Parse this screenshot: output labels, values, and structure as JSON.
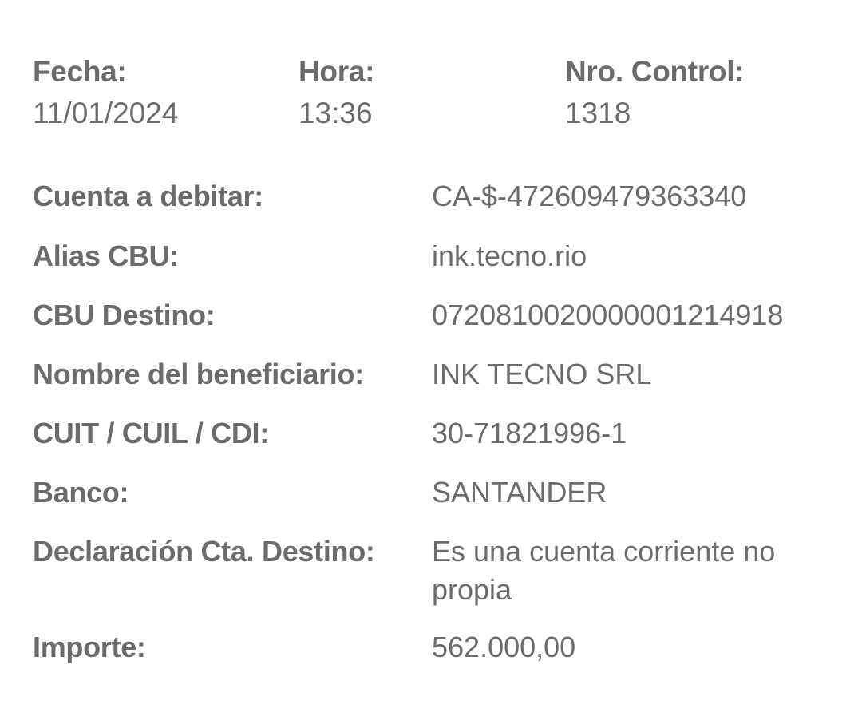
{
  "header": {
    "fecha_label": "Fecha:",
    "fecha_value": "11/01/2024",
    "hora_label": "Hora:",
    "hora_value": "13:36",
    "control_label": "Nro. Control:",
    "control_value": "1318"
  },
  "details": {
    "cuenta_label": "Cuenta a debitar:",
    "cuenta_value": "CA-$-472609479363340",
    "alias_label": "Alias CBU:",
    "alias_value": "ink.tecno.rio",
    "cbu_label": "CBU Destino:",
    "cbu_value": "0720810020000001214918",
    "nombre_label": "Nombre del beneficiario:",
    "nombre_value": "INK TECNO SRL",
    "cuit_label": "CUIT / CUIL / CDI:",
    "cuit_value": "30-71821996-1",
    "banco_label": "Banco:",
    "banco_value": "SANTANDER",
    "declaracion_label": "Declaración Cta. Destino:",
    "declaracion_value": "Es una cuenta corriente no propia",
    "importe_label": "Importe:",
    "importe_value": "562.000,00"
  }
}
